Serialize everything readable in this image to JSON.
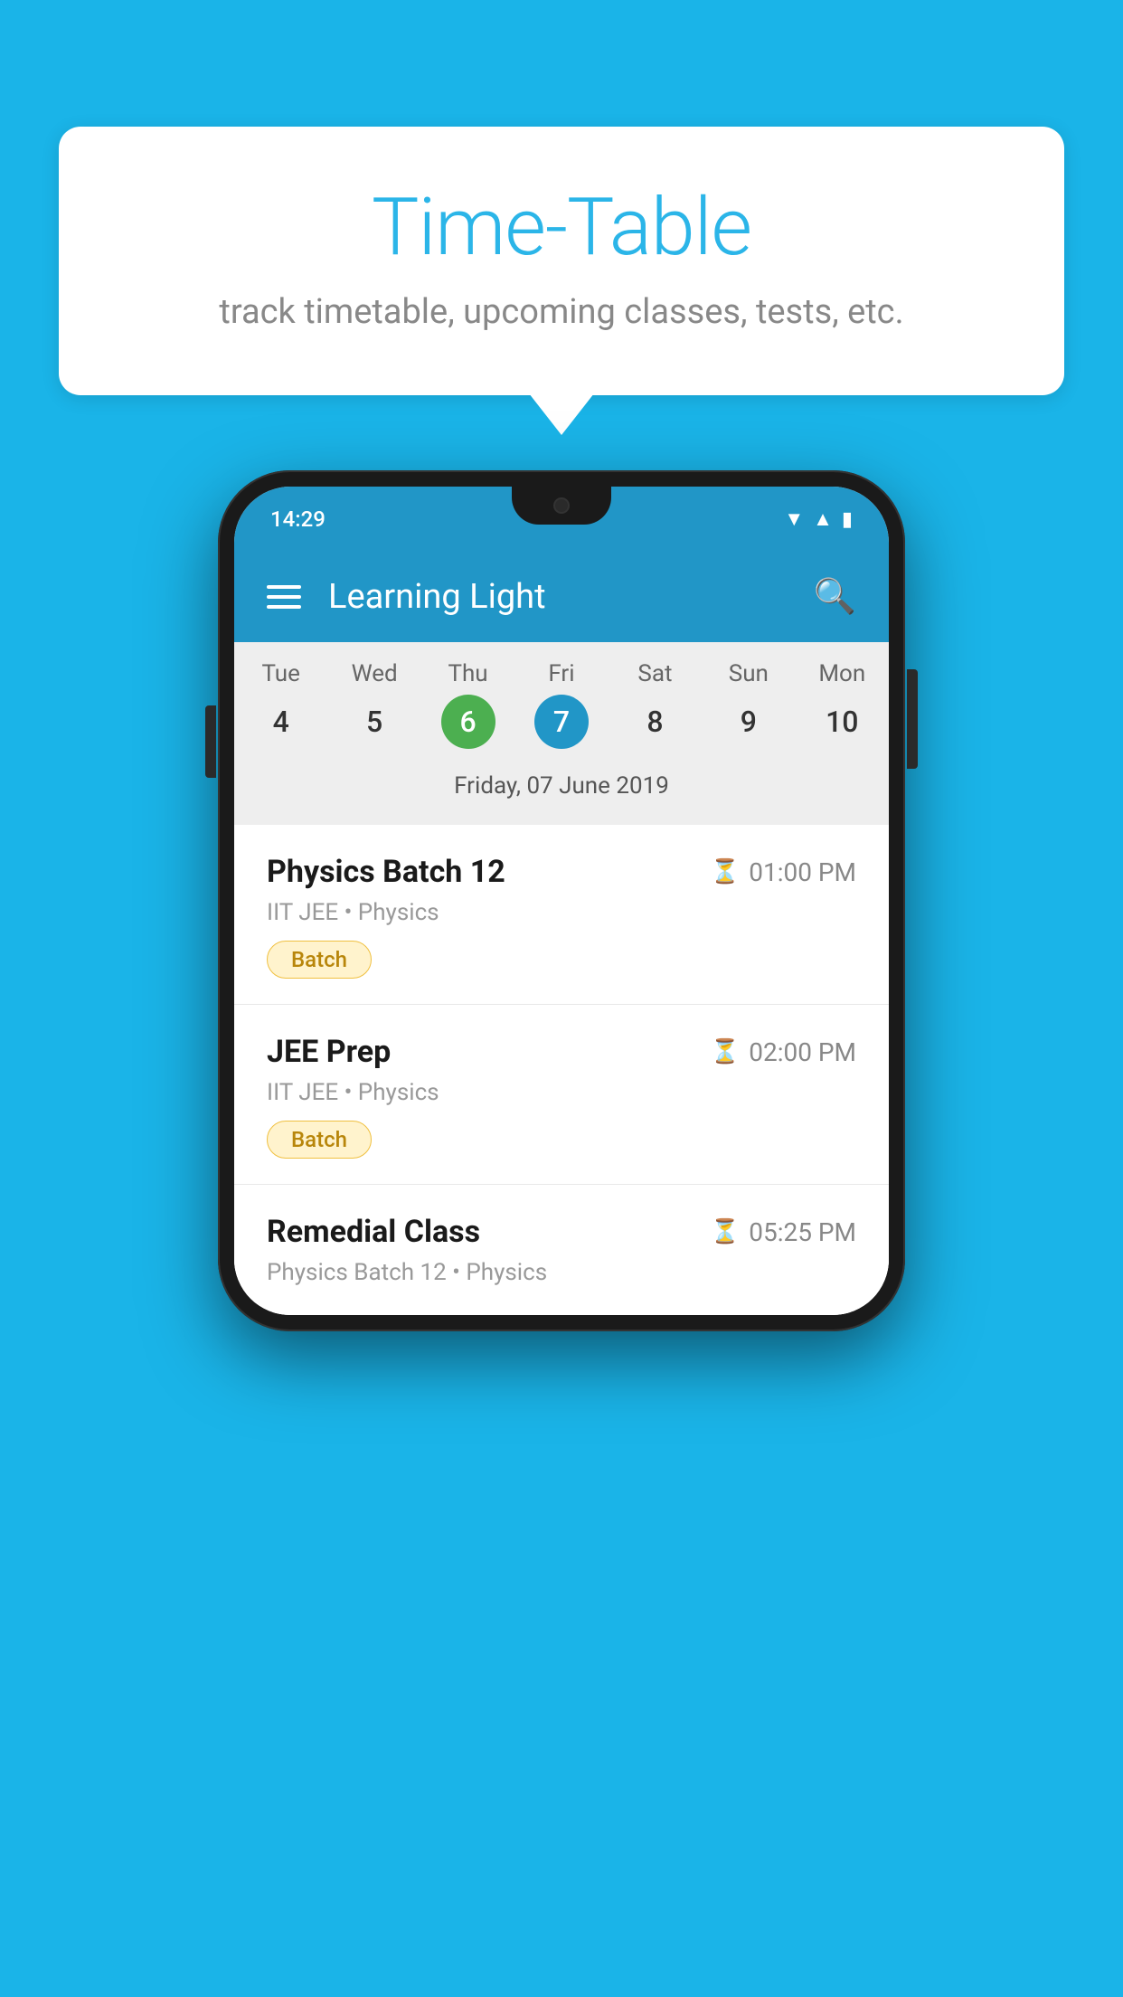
{
  "page": {
    "background_color": "#1ab4e8"
  },
  "speech_bubble": {
    "title": "Time-Table",
    "subtitle": "track timetable, upcoming classes, tests, etc."
  },
  "phone": {
    "status_bar": {
      "time": "14:29"
    },
    "toolbar": {
      "app_name": "Learning Light"
    },
    "calendar": {
      "days": [
        {
          "name": "Tue",
          "number": "4",
          "state": "normal"
        },
        {
          "name": "Wed",
          "number": "5",
          "state": "normal"
        },
        {
          "name": "Thu",
          "number": "6",
          "state": "today"
        },
        {
          "name": "Fri",
          "number": "7",
          "state": "selected"
        },
        {
          "name": "Sat",
          "number": "8",
          "state": "normal"
        },
        {
          "name": "Sun",
          "number": "9",
          "state": "normal"
        },
        {
          "name": "Mon",
          "number": "10",
          "state": "normal"
        }
      ],
      "selected_date_label": "Friday, 07 June 2019"
    },
    "schedule": [
      {
        "title": "Physics Batch 12",
        "time": "01:00 PM",
        "subtitle": "IIT JEE • Physics",
        "badge": "Batch"
      },
      {
        "title": "JEE Prep",
        "time": "02:00 PM",
        "subtitle": "IIT JEE • Physics",
        "badge": "Batch"
      },
      {
        "title": "Remedial Class",
        "time": "05:25 PM",
        "subtitle": "Physics Batch 12 • Physics",
        "badge": null
      }
    ]
  }
}
